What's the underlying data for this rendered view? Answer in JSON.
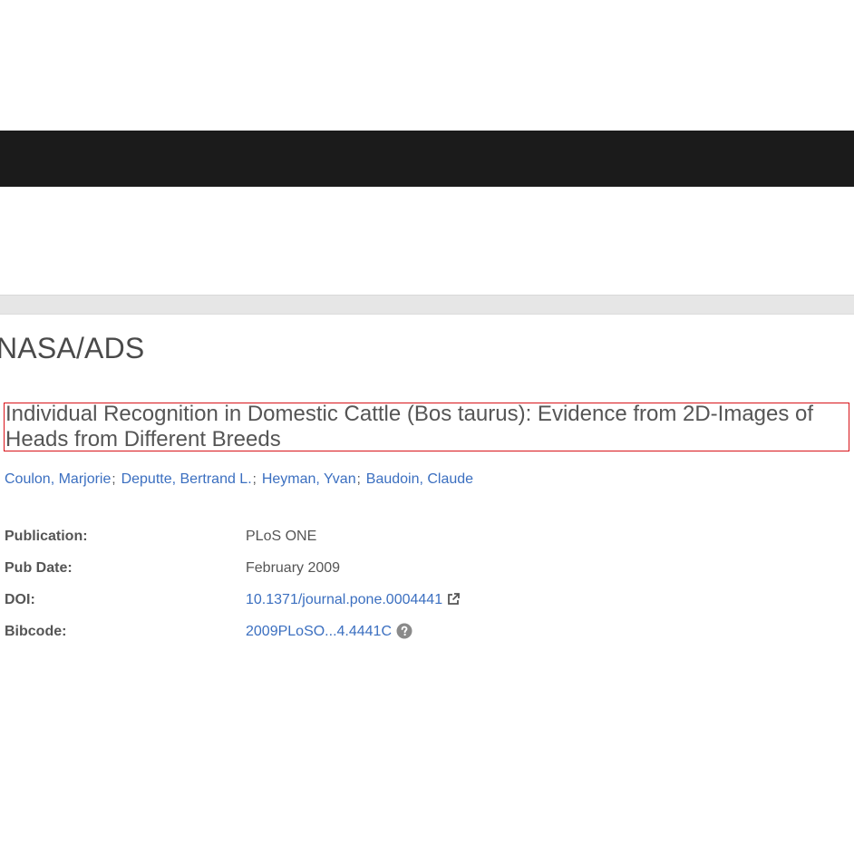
{
  "header": {
    "brand": "NASA/ADS"
  },
  "article": {
    "title": "Individual Recognition in Domestic Cattle (Bos taurus): Evidence from 2D-Images of Heads from Different Breeds",
    "authors": [
      "Coulon, Marjorie",
      "Deputte, Bertrand L.",
      "Heyman, Yvan",
      "Baudoin, Claude"
    ],
    "author_separator": ";",
    "details": {
      "publication_label": "Publication:",
      "publication_value": "PLoS ONE",
      "pub_date_label": "Pub Date:",
      "pub_date_value": "February 2009",
      "doi_label": "DOI:",
      "doi_value": "10.1371/journal.pone.0004441",
      "bibcode_label": "Bibcode:",
      "bibcode_value": "2009PLoSO...4.4441C"
    }
  },
  "colors": {
    "link": "#3b6fc0",
    "text": "#555555",
    "nav_bar": "#1b1b1b",
    "highlight_border": "#d9131a"
  },
  "icons": {
    "doi": "external-link-icon",
    "bibcode": "question-circle-icon"
  }
}
